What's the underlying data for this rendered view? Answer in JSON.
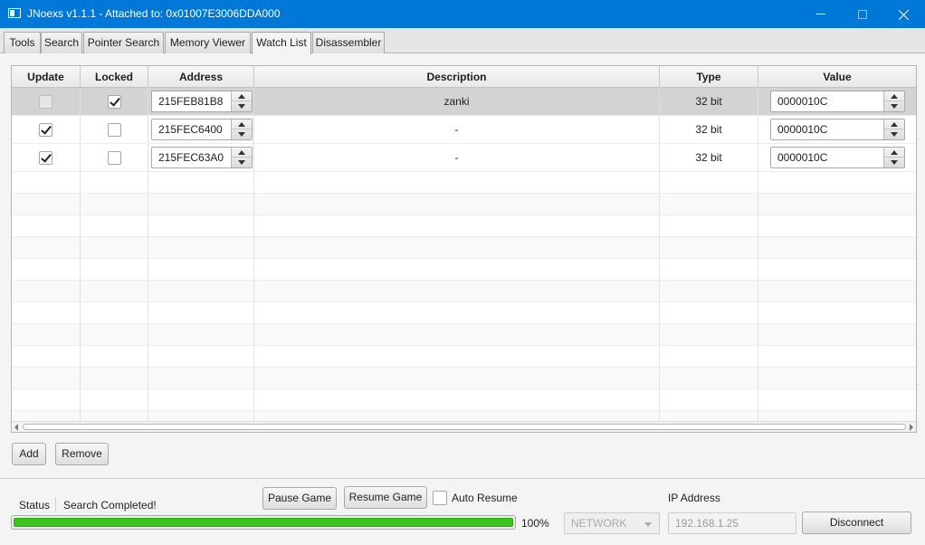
{
  "window": {
    "title": "JNoexs v1.1.1 - Attached to: 0x01007E3006DDA000"
  },
  "tabs": [
    {
      "label": "Tools"
    },
    {
      "label": "Search"
    },
    {
      "label": "Pointer Search"
    },
    {
      "label": "Memory Viewer"
    },
    {
      "label": "Watch List",
      "active": true
    },
    {
      "label": "Disassembler"
    }
  ],
  "watch_table": {
    "columns": [
      "Update",
      "Locked",
      "Address",
      "Description",
      "Type",
      "Value"
    ],
    "rows": [
      {
        "update": false,
        "locked": true,
        "address": "215FEB81B8",
        "description": "zanki",
        "type": "32 bit",
        "value": "0000010C",
        "selected": true
      },
      {
        "update": true,
        "locked": false,
        "address": "215FEC6400",
        "description": "-",
        "type": "32 bit",
        "value": "0000010C",
        "selected": false
      },
      {
        "update": true,
        "locked": false,
        "address": "215FEC63A0",
        "description": "-",
        "type": "32 bit",
        "value": "0000010C",
        "selected": false
      }
    ]
  },
  "actions": {
    "add_label": "Add",
    "remove_label": "Remove"
  },
  "footer": {
    "status_label": "Status",
    "status_text": "Search Completed!",
    "progress_percent": 100,
    "progress_text": "100%",
    "pause_label": "Pause Game",
    "resume_label": "Resume Game",
    "auto_resume_label": "Auto Resume",
    "auto_resume_checked": false,
    "connection_type": "NETWORK",
    "ip_label": "IP Address",
    "ip_value": "192.168.1.25",
    "disconnect_label": "Disconnect"
  },
  "colors": {
    "titlebar": "#0078d7",
    "progress_fill": "#3cc31d",
    "selected_row": "#d3d3d3"
  }
}
